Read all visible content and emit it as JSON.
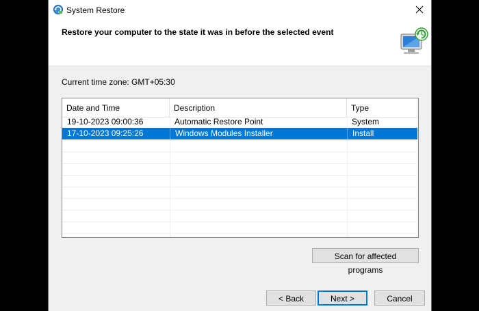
{
  "window": {
    "title": "System Restore",
    "header_text": "Restore your computer to the state it was in before the selected event"
  },
  "timezone_label": "Current time zone: GMT+05:30",
  "table": {
    "columns": [
      "Date and Time",
      "Description",
      "Type"
    ],
    "sorted_column": "Date and Time",
    "rows": [
      {
        "date": "19-10-2023 09:00:36",
        "description": "Automatic Restore Point",
        "type": "System",
        "selected": false
      },
      {
        "date": "17-10-2023 09:25:26",
        "description": "Windows Modules Installer",
        "type": "Install",
        "selected": true
      }
    ]
  },
  "buttons": {
    "scan": "Scan for affected programs",
    "back": "< Back",
    "next": "Next >",
    "cancel": "Cancel"
  },
  "colors": {
    "selection": "#0078d7",
    "dialog_bg": "#f0f0f0",
    "outer_bg": "#000000"
  },
  "icons": {
    "app": "system-restore-icon",
    "header": "restore-computer-icon",
    "close": "close-icon",
    "sort": "sort-indicator-icon"
  }
}
